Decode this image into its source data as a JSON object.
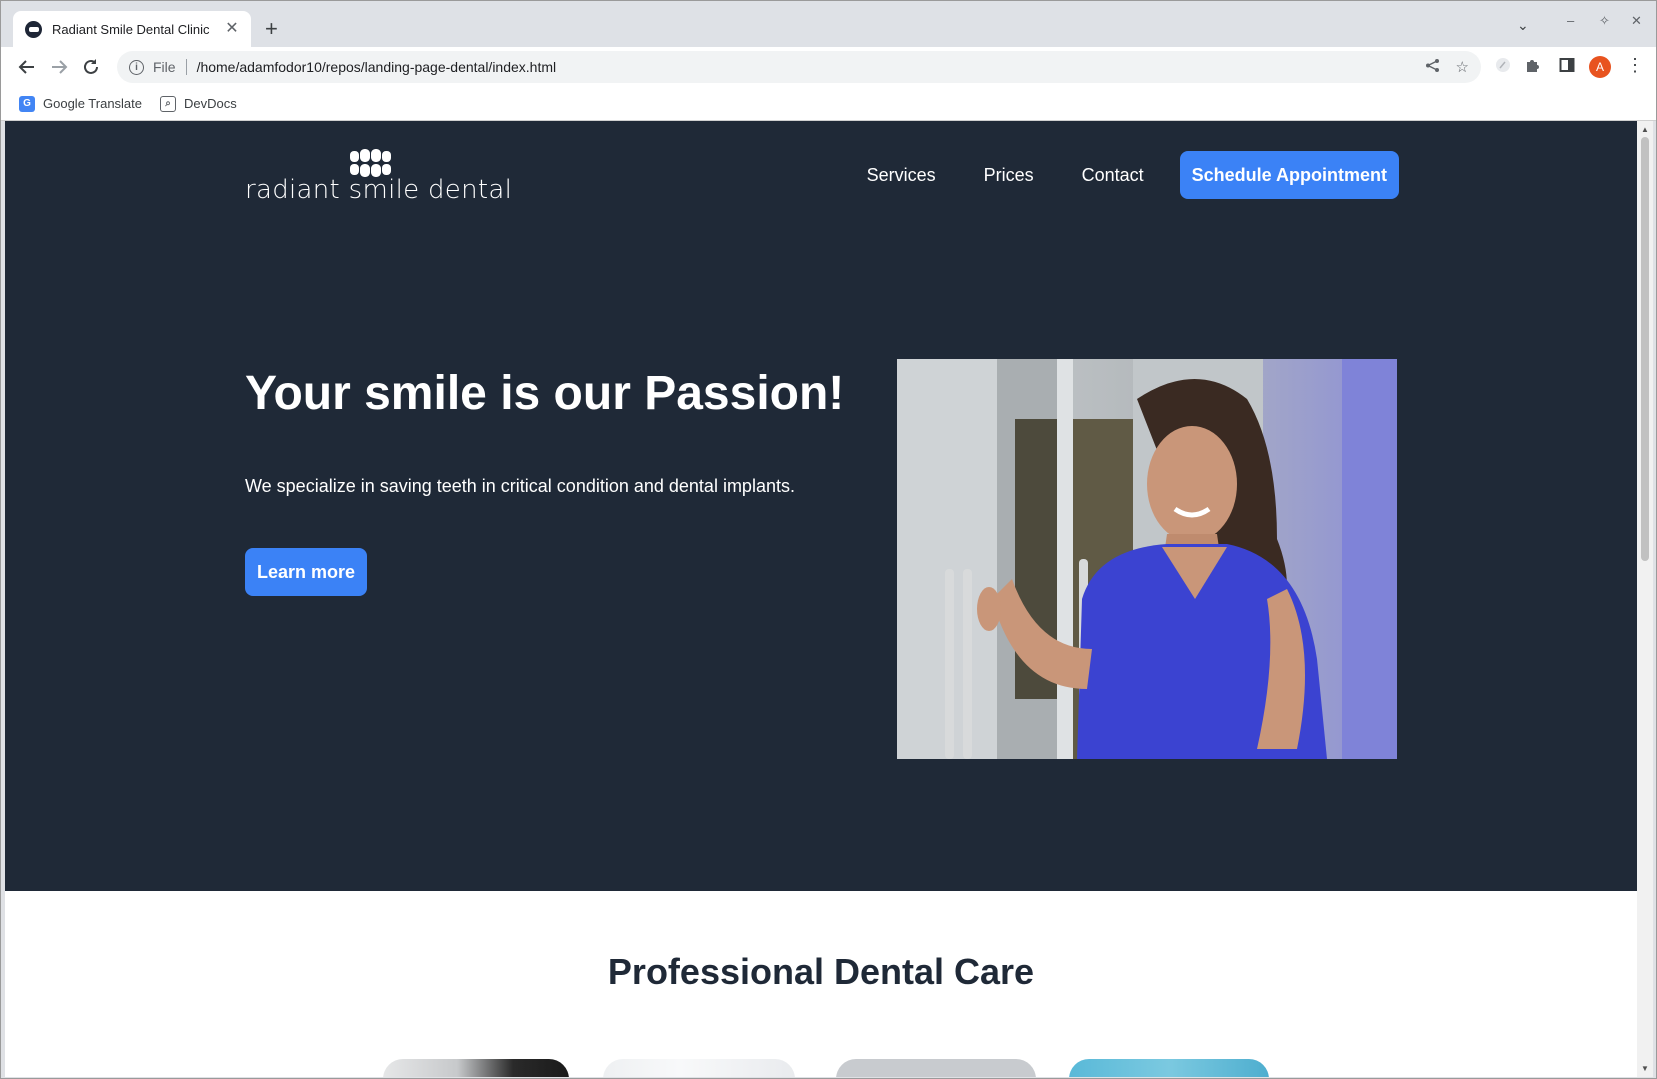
{
  "browser": {
    "tab_title": "Radiant Smile Dental Clinic",
    "new_tab_symbol": "+",
    "scheme_label": "File",
    "url": "/home/adamfodor10/repos/landing-page-dental/index.html",
    "profile_initial": "A",
    "bookmarks": [
      {
        "label": "Google Translate"
      },
      {
        "label": "DevDocs"
      }
    ]
  },
  "site": {
    "logo_text": "radiant smile dental",
    "nav": {
      "services": "Services",
      "prices": "Prices",
      "contact": "Contact",
      "cta": "Schedule Appointment"
    },
    "hero": {
      "headline": "Your smile is our Passion!",
      "subtext": "We specialize in saving teeth in critical condition and dental implants.",
      "button": "Learn more"
    },
    "services_title": "Professional Dental Care"
  },
  "colors": {
    "hero_bg": "#1f2937",
    "accent": "#3b82f6",
    "scrub_top": "#4338ca"
  }
}
